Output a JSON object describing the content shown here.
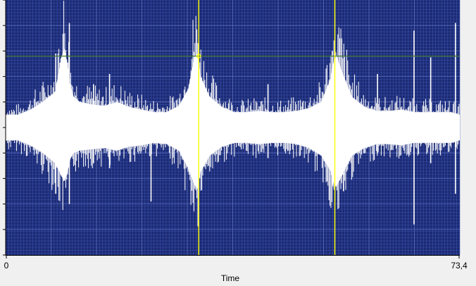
{
  "chart_data": {
    "type": "area",
    "title": "",
    "xlabel": "Time",
    "ylabel": "",
    "x_tick_labels": [
      "0",
      "73,4"
    ],
    "xlim": [
      0,
      73.4
    ],
    "ylim": [
      -1,
      1
    ],
    "grid": true,
    "legend": "none",
    "series": [
      {
        "x": [
          0,
          2,
          4,
          6,
          8,
          9,
          9.5,
          10,
          10.5,
          11,
          12,
          14,
          16,
          18,
          20,
          22,
          24,
          26,
          28,
          29.5,
          30.5,
          31,
          31.5,
          33,
          35,
          37,
          39,
          41,
          43,
          45,
          47,
          49,
          51,
          52.5,
          53,
          53.5,
          54.5,
          56,
          58,
          60,
          62,
          64,
          66,
          68,
          70,
          72,
          73.4
        ],
        "upper": [
          0.1,
          0.1,
          0.14,
          0.2,
          0.28,
          0.55,
          0.62,
          0.5,
          0.32,
          0.24,
          0.2,
          0.18,
          0.17,
          0.2,
          0.16,
          0.14,
          0.12,
          0.12,
          0.17,
          0.3,
          0.55,
          0.58,
          0.4,
          0.24,
          0.16,
          0.12,
          0.12,
          0.13,
          0.12,
          0.12,
          0.13,
          0.15,
          0.2,
          0.38,
          0.52,
          0.56,
          0.42,
          0.24,
          0.16,
          0.13,
          0.13,
          0.14,
          0.12,
          0.12,
          0.12,
          0.12,
          0.1
        ],
        "lower": [
          -0.1,
          -0.1,
          -0.14,
          -0.2,
          -0.28,
          -0.38,
          -0.42,
          -0.35,
          -0.24,
          -0.2,
          -0.18,
          -0.17,
          -0.16,
          -0.18,
          -0.15,
          -0.14,
          -0.12,
          -0.13,
          -0.18,
          -0.32,
          -0.45,
          -0.48,
          -0.35,
          -0.22,
          -0.15,
          -0.12,
          -0.12,
          -0.13,
          -0.12,
          -0.12,
          -0.13,
          -0.16,
          -0.22,
          -0.34,
          -0.44,
          -0.46,
          -0.36,
          -0.22,
          -0.16,
          -0.13,
          -0.13,
          -0.14,
          -0.12,
          -0.12,
          -0.12,
          -0.12,
          -0.1
        ]
      }
    ],
    "spikes": [
      {
        "x": 8.1,
        "lo": -0.52,
        "hi": 0.58
      },
      {
        "x": 10.3,
        "lo": -0.6,
        "hi": 0.82
      },
      {
        "x": 14.2,
        "lo": -0.28,
        "hi": 0.34
      },
      {
        "x": 16.8,
        "lo": -0.32,
        "hi": 0.42
      },
      {
        "x": 23.5,
        "lo": -0.58,
        "hi": 0.14
      },
      {
        "x": 31.2,
        "lo": -0.5,
        "hi": 0.6
      },
      {
        "x": 42.4,
        "lo": -0.24,
        "hi": 0.34
      },
      {
        "x": 52.8,
        "lo": -0.45,
        "hi": 0.6
      },
      {
        "x": 54.6,
        "lo": -0.5,
        "hi": 0.24
      },
      {
        "x": 60.1,
        "lo": -0.2,
        "hi": 0.42
      },
      {
        "x": 66.0,
        "lo": -0.76,
        "hi": 0.76
      },
      {
        "x": 68.7,
        "lo": -0.28,
        "hi": 0.55
      },
      {
        "x": 72.7,
        "lo": -0.52,
        "hi": 0.82
      }
    ],
    "markers": [
      {
        "x": 31.2,
        "color": "#ffff00"
      },
      {
        "x": 53.2,
        "color": "#ffff00"
      }
    ],
    "threshold": {
      "y": 0.56,
      "color": "#3f7a2e"
    },
    "colors": {
      "plot_background": "#1c2a73",
      "grid_fine": "#3e56b5",
      "grid_major": "#6a7fd0",
      "signal": "#ffffff",
      "axis": "#000000",
      "window_background": "#f0f0f0"
    }
  }
}
